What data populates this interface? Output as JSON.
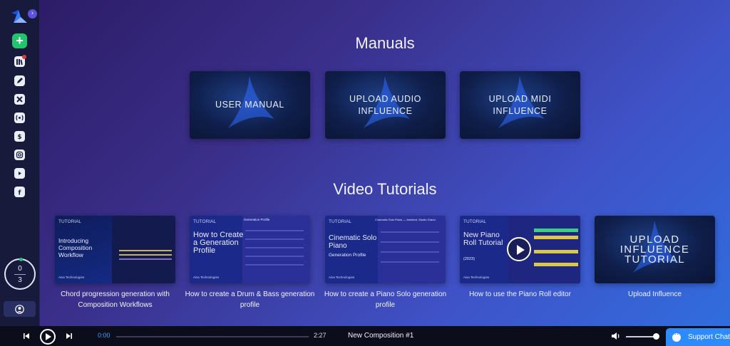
{
  "sidebar": {
    "expand_icon": "chevron-right-icon",
    "add_icon": "plus-icon",
    "items": [
      {
        "name": "library",
        "icon": "library-icon",
        "has_notification": true
      },
      {
        "name": "edit",
        "icon": "pencil-icon"
      },
      {
        "name": "tools",
        "icon": "tools-icon"
      },
      {
        "name": "broadcast",
        "icon": "broadcast-icon"
      },
      {
        "name": "pricing",
        "icon": "dollar-icon"
      },
      {
        "name": "instagram",
        "icon": "instagram-icon"
      },
      {
        "name": "youtube",
        "icon": "youtube-play-icon"
      },
      {
        "name": "facebook",
        "icon": "facebook-icon"
      }
    ],
    "credits": {
      "used": "0",
      "total": "3"
    },
    "account_icon": "user-icon"
  },
  "manuals": {
    "title": "Manuals",
    "cards": [
      {
        "label": "USER MANUAL"
      },
      {
        "label": "UPLOAD AUDIO INFLUENCE"
      },
      {
        "label": "UPLOAD MIDI INFLUENCE"
      }
    ]
  },
  "videos": {
    "title": "Video Tutorials",
    "cards": [
      {
        "thumb_tag": "TUTORIAL",
        "thumb_title": "Introducing Composition Workflow",
        "thumb_brand": "Aiva Technologies",
        "caption": "Chord progression generation with Composition Workflows"
      },
      {
        "thumb_tag": "TUTORIAL",
        "thumb_title": "How to Create a Generation Profile",
        "thumb_brand": "Aiva Technologies",
        "thumb_panel": "Generation Profile",
        "caption": "How to create a Drum & Bass generation profile"
      },
      {
        "thumb_tag": "TUTORIAL",
        "thumb_title": "Cinematic Solo Piano",
        "thumb_subtitle": "Generation Profile",
        "thumb_brand": "Aiva Technologies",
        "thumb_panel": "Cinematic Solo Piano — Ambient, Studio Grand",
        "caption": "How to create a Piano Solo generation profile"
      },
      {
        "thumb_tag": "TUTORIAL",
        "thumb_title": "New Piano Roll Tutorial",
        "thumb_year": "(2023)",
        "thumb_brand": "Aiva Technologies",
        "caption": "How to use the Piano Roll editor"
      },
      {
        "thumb_title": "UPLOAD INFLUENCE TUTORIAL",
        "caption": "Upload Influence"
      }
    ]
  },
  "player": {
    "current_time": "0:00",
    "duration": "2:27",
    "progress": 0,
    "song_title": "New Composition #1",
    "volume": 0.9
  },
  "support": {
    "label": "Support Chat"
  },
  "colors": {
    "accent": "#2e8bff",
    "add_button": "#22c46e",
    "sidebar": "#171a3a",
    "notification": "#e53a3a"
  }
}
